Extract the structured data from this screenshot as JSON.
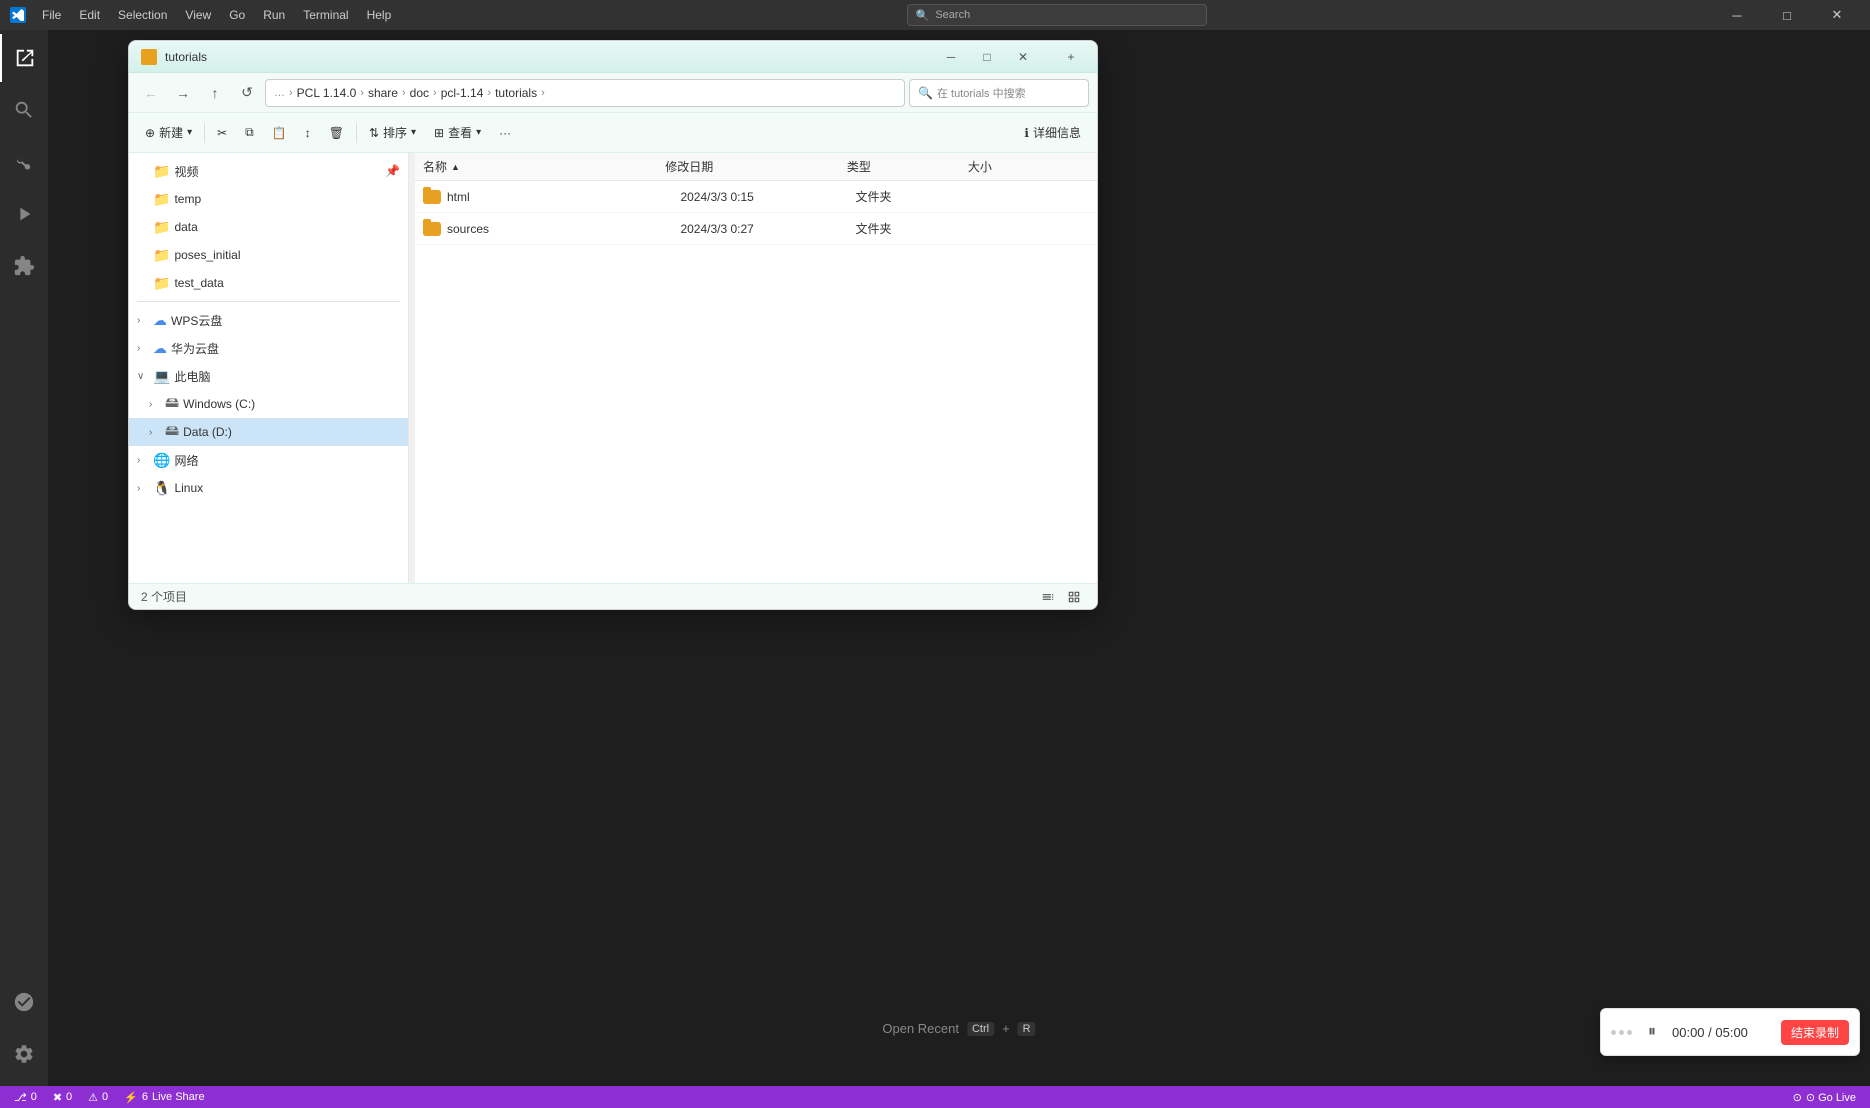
{
  "titleBar": {
    "menu": [
      "File",
      "Edit",
      "Selection",
      "View",
      "Go",
      "Run",
      "Terminal",
      "Help"
    ],
    "search": "Search",
    "controls": [
      "minimize",
      "maximize",
      "close"
    ]
  },
  "activityBar": {
    "items": [
      "explorer",
      "search",
      "source-control",
      "debug",
      "extensions",
      "account",
      "settings"
    ]
  },
  "fileExplorer": {
    "title": "tutorials",
    "navigation": {
      "back": "←",
      "forward": "→",
      "up": "↑",
      "refresh": "↺",
      "addressParts": [
        "PCL 1.14.0",
        "share",
        "doc",
        "pcl-1.14",
        "tutorials"
      ],
      "searchPlaceholder": "在 tutorials 中搜索"
    },
    "toolbar": {
      "new": "新建",
      "cut": "✂",
      "copy": "□",
      "paste": "□",
      "share": "↕",
      "delete": "🗑",
      "sort": "排序",
      "view": "查看",
      "more": "···",
      "details": "详细信息"
    },
    "sidebarItems": [
      {
        "label": "视频",
        "indent": 0,
        "icon": "📁",
        "pinned": true
      },
      {
        "label": "temp",
        "indent": 0,
        "icon": "📁"
      },
      {
        "label": "data",
        "indent": 0,
        "icon": "📁"
      },
      {
        "label": "poses_initial",
        "indent": 0,
        "icon": "📁"
      },
      {
        "label": "test_data",
        "indent": 0,
        "icon": "📁"
      },
      {
        "label": "WPS云盘",
        "indent": 0,
        "icon": "☁",
        "expandable": true
      },
      {
        "label": "华为云盘",
        "indent": 0,
        "icon": "☁",
        "expandable": true
      },
      {
        "label": "此电脑",
        "indent": 0,
        "icon": "💻",
        "expandable": true,
        "expanded": true
      },
      {
        "label": "Windows (C:)",
        "indent": 1,
        "icon": "💾",
        "expandable": true
      },
      {
        "label": "Data (D:)",
        "indent": 1,
        "icon": "💾",
        "expandable": true,
        "selected": true
      },
      {
        "label": "网络",
        "indent": 0,
        "icon": "🌐",
        "expandable": true
      },
      {
        "label": "Linux",
        "indent": 0,
        "icon": "🐧",
        "expandable": true
      }
    ],
    "columns": {
      "name": "名称",
      "date": "修改日期",
      "type": "类型",
      "size": "大小"
    },
    "files": [
      {
        "name": "html",
        "date": "2024/3/3 0:15",
        "type": "文件夹",
        "size": ""
      },
      {
        "name": "sources",
        "date": "2024/3/3 0:27",
        "type": "文件夹",
        "size": ""
      }
    ],
    "statusText": "2 个项目"
  },
  "statusBar": {
    "sourceControl": "⎇ 0",
    "warnings": "⚠ 0",
    "errors": "✖ 0",
    "liveShare": "⚡ Live Share",
    "liveShareCount": "6",
    "goLive": "⊙ Go Live"
  },
  "recordingWidget": {
    "time": "00:00 / 05:00",
    "endBtn": "结束录制"
  },
  "openRecentHint": {
    "text": "Open Recent",
    "shortcut": "Ctrl + R"
  }
}
